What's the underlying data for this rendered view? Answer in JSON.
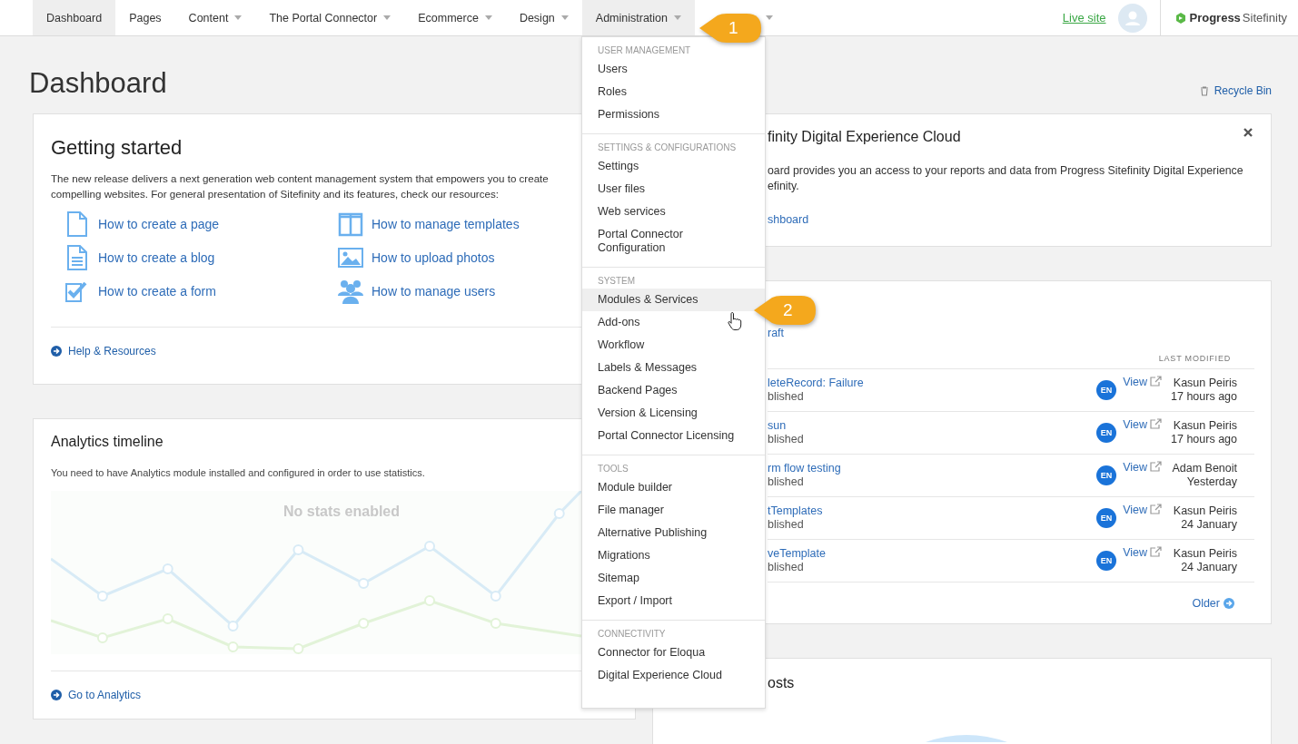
{
  "nav": {
    "items": [
      {
        "label": "Dashboard",
        "highlighted": true,
        "has_caret": false
      },
      {
        "label": "Pages",
        "highlighted": false,
        "has_caret": false
      },
      {
        "label": "Content",
        "highlighted": false,
        "has_caret": true
      },
      {
        "label": "The Portal Connector",
        "highlighted": false,
        "has_caret": true
      },
      {
        "label": "Ecommerce",
        "highlighted": false,
        "has_caret": true
      },
      {
        "label": "Design",
        "highlighted": false,
        "has_caret": true
      },
      {
        "label": "Administration",
        "highlighted": true,
        "has_caret": true
      },
      {
        "highlighted": false,
        "has_caret": true
      }
    ],
    "live_site": "Live site",
    "logo": {
      "brand": "Progress",
      "product": "Sitefinity"
    }
  },
  "page_title": "Dashboard",
  "recycle_bin": "Recycle Bin",
  "getting_started": {
    "title": "Getting started",
    "intro_lines": [
      "The new release delivers a next generation web content management system that empowers you to create",
      "compelling websites. For general presentation of Sitefinity and its features, check our resources:"
    ],
    "links": [
      {
        "label": "How to create a page",
        "kind": "page"
      },
      {
        "label": "How to manage templates",
        "kind": "templates"
      },
      {
        "label": "How to create a blog",
        "kind": "blog"
      },
      {
        "label": "How to upload photos",
        "kind": "photos"
      },
      {
        "label": "How to create a form",
        "kind": "form"
      },
      {
        "label": "How to manage users",
        "kind": "users"
      }
    ],
    "footer_link": "Help & Resources"
  },
  "analytics": {
    "title": "Analytics timeline",
    "message": "You need to have Analytics module installed and configured in order to use statistics.",
    "empty_text": "No stats enabled",
    "footer_link": "Go to Analytics"
  },
  "cloud_card": {
    "title": "finity Digital Experience Cloud",
    "body_lines": [
      "oard provides you an access to your reports and data from Progress Sitefinity Digital Experience",
      "efinity."
    ],
    "link": "shboard"
  },
  "recent": {
    "filter_link": "raft",
    "column_header": "LAST MODIFIED",
    "rows": [
      {
        "title": "leteRecord: Failure",
        "status": "blished",
        "language": "EN",
        "view": "View",
        "author": "Kasun Peiris",
        "time": "17 hours ago"
      },
      {
        "title": "sun",
        "status": "blished",
        "language": "EN",
        "view": "View",
        "author": "Kasun Peiris",
        "time": "17 hours ago"
      },
      {
        "title": "rm flow testing",
        "status": "blished",
        "language": "EN",
        "view": "View",
        "author": "Adam Benoit",
        "time": "Yesterday"
      },
      {
        "title": "tTemplates",
        "status": "blished",
        "language": "EN",
        "view": "View",
        "author": "Kasun Peiris",
        "time": "24 January"
      },
      {
        "title": "veTemplate",
        "status": "blished",
        "language": "EN",
        "view": "View",
        "author": "Kasun Peiris",
        "time": "24 January"
      }
    ],
    "older": "Older"
  },
  "posts": {
    "title": "osts"
  },
  "menu": {
    "sections": [
      {
        "header": "USER MANAGEMENT",
        "items": [
          {
            "label": "Users",
            "hovered": false
          },
          {
            "label": "Roles",
            "hovered": false
          },
          {
            "label": "Permissions",
            "hovered": false
          }
        ]
      },
      {
        "header": "SETTINGS & CONFIGURATIONS",
        "items": [
          {
            "label": "Settings",
            "hovered": false
          },
          {
            "label": "User files",
            "hovered": false
          },
          {
            "label": "Web services",
            "hovered": false
          },
          {
            "label": "Portal Connector Configuration",
            "hovered": false
          }
        ]
      },
      {
        "header": "SYSTEM",
        "items": [
          {
            "label": "Modules & Services",
            "hovered": true
          },
          {
            "label": "Add-ons",
            "hovered": false
          },
          {
            "label": "Workflow",
            "hovered": false
          },
          {
            "label": "Labels & Messages",
            "hovered": false
          },
          {
            "label": "Backend Pages",
            "hovered": false
          },
          {
            "label": "Version & Licensing",
            "hovered": false
          },
          {
            "label": "Portal Connector Licensing",
            "hovered": false
          }
        ]
      },
      {
        "header": "TOOLS",
        "items": [
          {
            "label": "Module builder",
            "hovered": false
          },
          {
            "label": "File manager",
            "hovered": false
          },
          {
            "label": "Alternative Publishing",
            "hovered": false
          },
          {
            "label": "Migrations",
            "hovered": false
          },
          {
            "label": "Sitemap",
            "hovered": false
          },
          {
            "label": "Export / Import",
            "hovered": false
          }
        ]
      },
      {
        "header": "CONNECTIVITY",
        "items": [
          {
            "label": "Connector for Eloqua",
            "hovered": false
          },
          {
            "label": "Digital Experience Cloud",
            "hovered": false
          }
        ]
      }
    ]
  },
  "callouts": [
    {
      "number": "1"
    },
    {
      "number": "2"
    }
  ]
}
